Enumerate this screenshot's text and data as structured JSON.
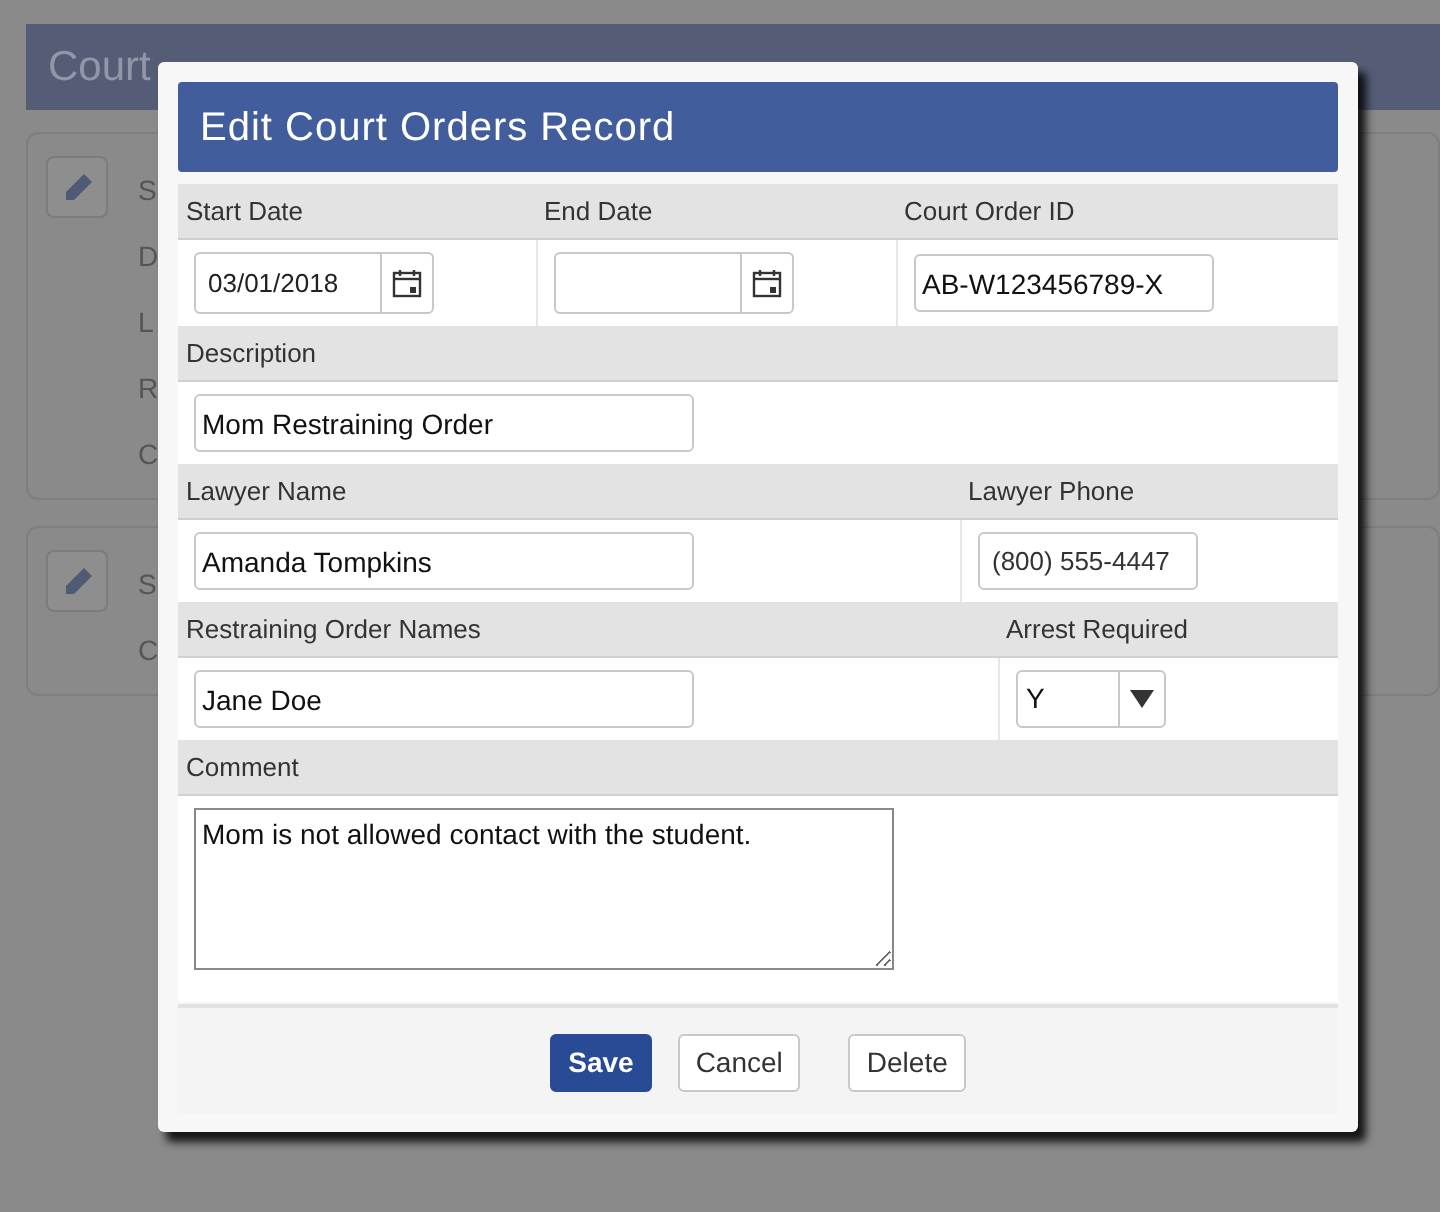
{
  "page": {
    "title": "Court",
    "cards": [
      {
        "labels": [
          "S",
          "D",
          "L",
          "R",
          "C"
        ]
      },
      {
        "labels": [
          "S",
          "C"
        ]
      }
    ]
  },
  "dialog": {
    "title": "Edit Court Orders Record",
    "rows": [
      {
        "fields": [
          {
            "label": "Start Date",
            "kind": "date",
            "value": "03/01/2018"
          },
          {
            "label": "End Date",
            "kind": "date"
          },
          {
            "label": "Court Order ID",
            "kind": "text",
            "value": "AB-W123456789-X"
          }
        ]
      },
      {
        "fields": [
          {
            "label": "Description",
            "kind": "text",
            "value": "Mom Restraining Order"
          }
        ]
      },
      {
        "fields": [
          {
            "label": "Lawyer Name",
            "kind": "text",
            "value": "Amanda Tompkins"
          },
          {
            "label": "Lawyer Phone",
            "kind": "phone",
            "value": "(800) 555-4447"
          }
        ]
      },
      {
        "fields": [
          {
            "label": "Restraining Order Names",
            "kind": "text",
            "value": "Jane Doe"
          },
          {
            "label": "Arrest Required",
            "kind": "select",
            "value": "Y"
          }
        ]
      },
      {
        "fields": [
          {
            "label": "Comment",
            "kind": "textarea",
            "value": "Mom is not allowed contact with the student."
          }
        ]
      }
    ],
    "buttons": [
      {
        "label": "Save",
        "primary": true
      },
      {
        "label": "Cancel",
        "primary": false
      },
      {
        "label": "Delete",
        "primary": false
      }
    ]
  }
}
